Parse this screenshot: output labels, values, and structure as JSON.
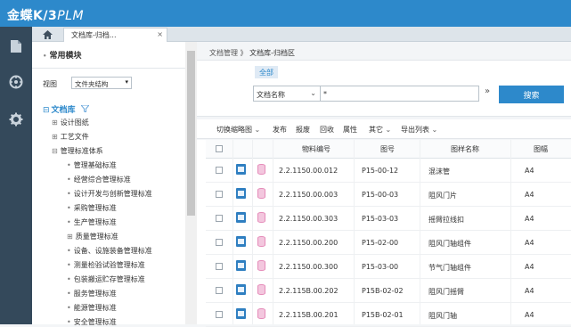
{
  "app": {
    "logo_main": "金蝶K/3",
    "logo_sub": "PLM"
  },
  "nav": {
    "icons": [
      "document-icon",
      "compass-icon",
      "gear-icon"
    ]
  },
  "tabs": {
    "active_label": "文档库-归档...",
    "close": "×"
  },
  "sidebar": {
    "common_modules": "常用模块",
    "view_label": "视图",
    "view_value": "文件夹结构",
    "tree_root": "文档库",
    "tree": [
      {
        "prefix": "⊞",
        "label": "设计图纸"
      },
      {
        "prefix": "⊞",
        "label": "工艺文件"
      },
      {
        "prefix": "⊟",
        "label": "管理标准体系"
      },
      {
        "prefix": "•",
        "label": "管理基础标准"
      },
      {
        "prefix": "•",
        "label": "经营综合管理标准"
      },
      {
        "prefix": "•",
        "label": "设计开发与创新管理标准"
      },
      {
        "prefix": "•",
        "label": "采购管理标准"
      },
      {
        "prefix": "•",
        "label": "生产管理标准"
      },
      {
        "prefix": "⊞",
        "label": "质量管理标准"
      },
      {
        "prefix": "•",
        "label": "设备、设施装备管理标准"
      },
      {
        "prefix": "•",
        "label": "测量检验试验管理标准"
      },
      {
        "prefix": "•",
        "label": "包装搬运贮存管理标准"
      },
      {
        "prefix": "•",
        "label": "服务管理标准"
      },
      {
        "prefix": "•",
        "label": "能源管理标准"
      },
      {
        "prefix": "•",
        "label": "安全管理标准"
      }
    ]
  },
  "main": {
    "breadcrumb_root": "文档管理",
    "breadcrumb_sep": "》",
    "breadcrumb_current": "文档库-归档区",
    "filter_all": "全部",
    "field_select": "文档名称",
    "search_value": "*",
    "search_button": "搜索",
    "toolbar": [
      {
        "label": "切换缩略图",
        "dropdown": true
      },
      {
        "label": "发布",
        "dropdown": false
      },
      {
        "label": "报废",
        "dropdown": false
      },
      {
        "label": "回收",
        "dropdown": false
      },
      {
        "label": "属性",
        "dropdown": false
      },
      {
        "label": "其它",
        "dropdown": true
      },
      {
        "label": "导出列表",
        "dropdown": true
      }
    ],
    "columns": [
      "物料编号",
      "图号",
      "图样名称",
      "图幅"
    ],
    "rows": [
      {
        "material": "2.2.1150.00.012",
        "drawing": "P15-00-12",
        "name": "混沫管",
        "size": "A4"
      },
      {
        "material": "2.2.1150.00.003",
        "drawing": "P15-00-03",
        "name": "阻风门片",
        "size": "A4"
      },
      {
        "material": "2.2.1150.00.303",
        "drawing": "P15-03-03",
        "name": "摇臂拉线扣",
        "size": "A4"
      },
      {
        "material": "2.2.1150.00.200",
        "drawing": "P15-02-00",
        "name": "阻风门轴组件",
        "size": "A4"
      },
      {
        "material": "2.2.1150.00.300",
        "drawing": "P15-03-00",
        "name": "节气门轴组件",
        "size": "A4"
      },
      {
        "material": "2.2.115B.00.202",
        "drawing": "P15B-02-02",
        "name": "阻风门摇臂",
        "size": "A4"
      },
      {
        "material": "2.2.115B.00.201",
        "drawing": "P15B-02-01",
        "name": "阻风门轴",
        "size": "A4"
      }
    ]
  }
}
